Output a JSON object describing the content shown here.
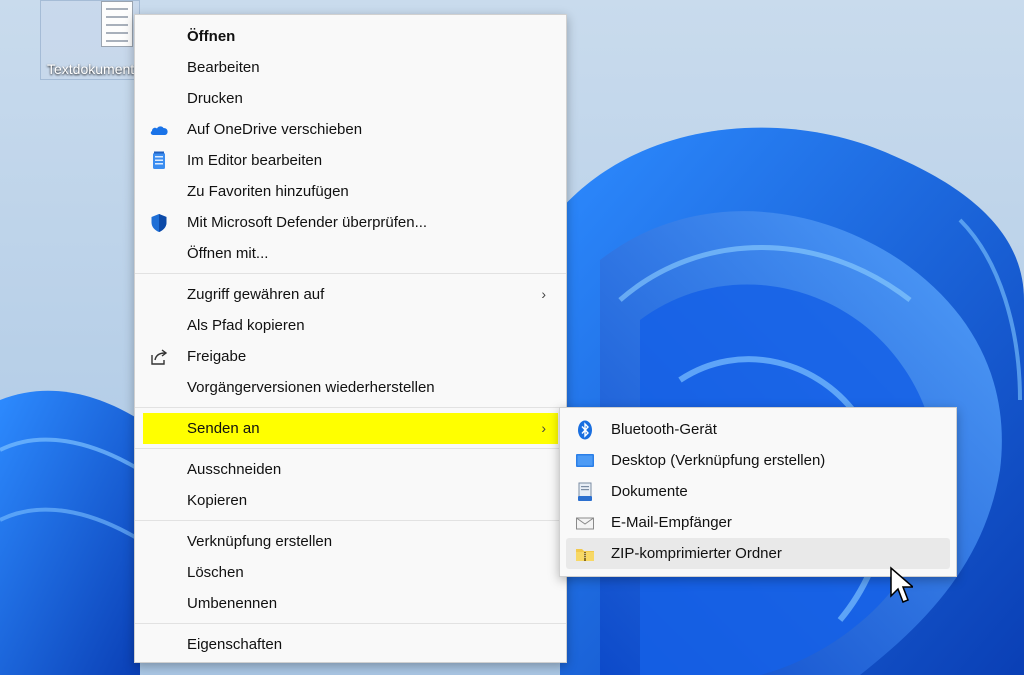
{
  "desktop": {
    "icon_label": "Textdokument"
  },
  "context_menu": {
    "items": [
      {
        "label": "Öffnen"
      },
      {
        "label": "Bearbeiten"
      },
      {
        "label": "Drucken"
      },
      {
        "label": "Auf OneDrive verschieben",
        "icon": "onedrive-cloud-icon"
      },
      {
        "label": "Im Editor bearbeiten",
        "icon": "notepad-icon"
      },
      {
        "label": "Zu Favoriten hinzufügen"
      },
      {
        "label": "Mit Microsoft Defender überprüfen...",
        "icon": "defender-shield-icon"
      },
      {
        "label": "Öffnen mit..."
      },
      {
        "label": "Zugriff gewähren auf",
        "arrow": "›"
      },
      {
        "label": "Als Pfad kopieren"
      },
      {
        "label": "Freigabe",
        "icon": "share-icon"
      },
      {
        "label": "Vorgängerversionen wiederherstellen"
      },
      {
        "label": "Senden an",
        "arrow": "›",
        "highlight_color": "#ffff00"
      },
      {
        "label": "Ausschneiden"
      },
      {
        "label": "Kopieren"
      },
      {
        "label": "Verknüpfung erstellen"
      },
      {
        "label": "Löschen"
      },
      {
        "label": "Umbenennen"
      },
      {
        "label": "Eigenschaften"
      }
    ]
  },
  "sendto_submenu": {
    "items": [
      {
        "label": "Bluetooth-Gerät",
        "icon": "bluetooth-icon"
      },
      {
        "label": "Desktop (Verknüpfung erstellen)",
        "icon": "desktop-icon"
      },
      {
        "label": "Dokumente",
        "icon": "documents-icon"
      },
      {
        "label": "E-Mail-Empfänger",
        "icon": "mail-icon"
      },
      {
        "label": "ZIP-komprimierter Ordner",
        "icon": "zip-folder-icon",
        "hovered": true
      }
    ]
  },
  "colors": {
    "highlight": "#ffff00",
    "accent_blue": "#1a6fe0",
    "wallpaper_light": "#b9cfe6"
  }
}
